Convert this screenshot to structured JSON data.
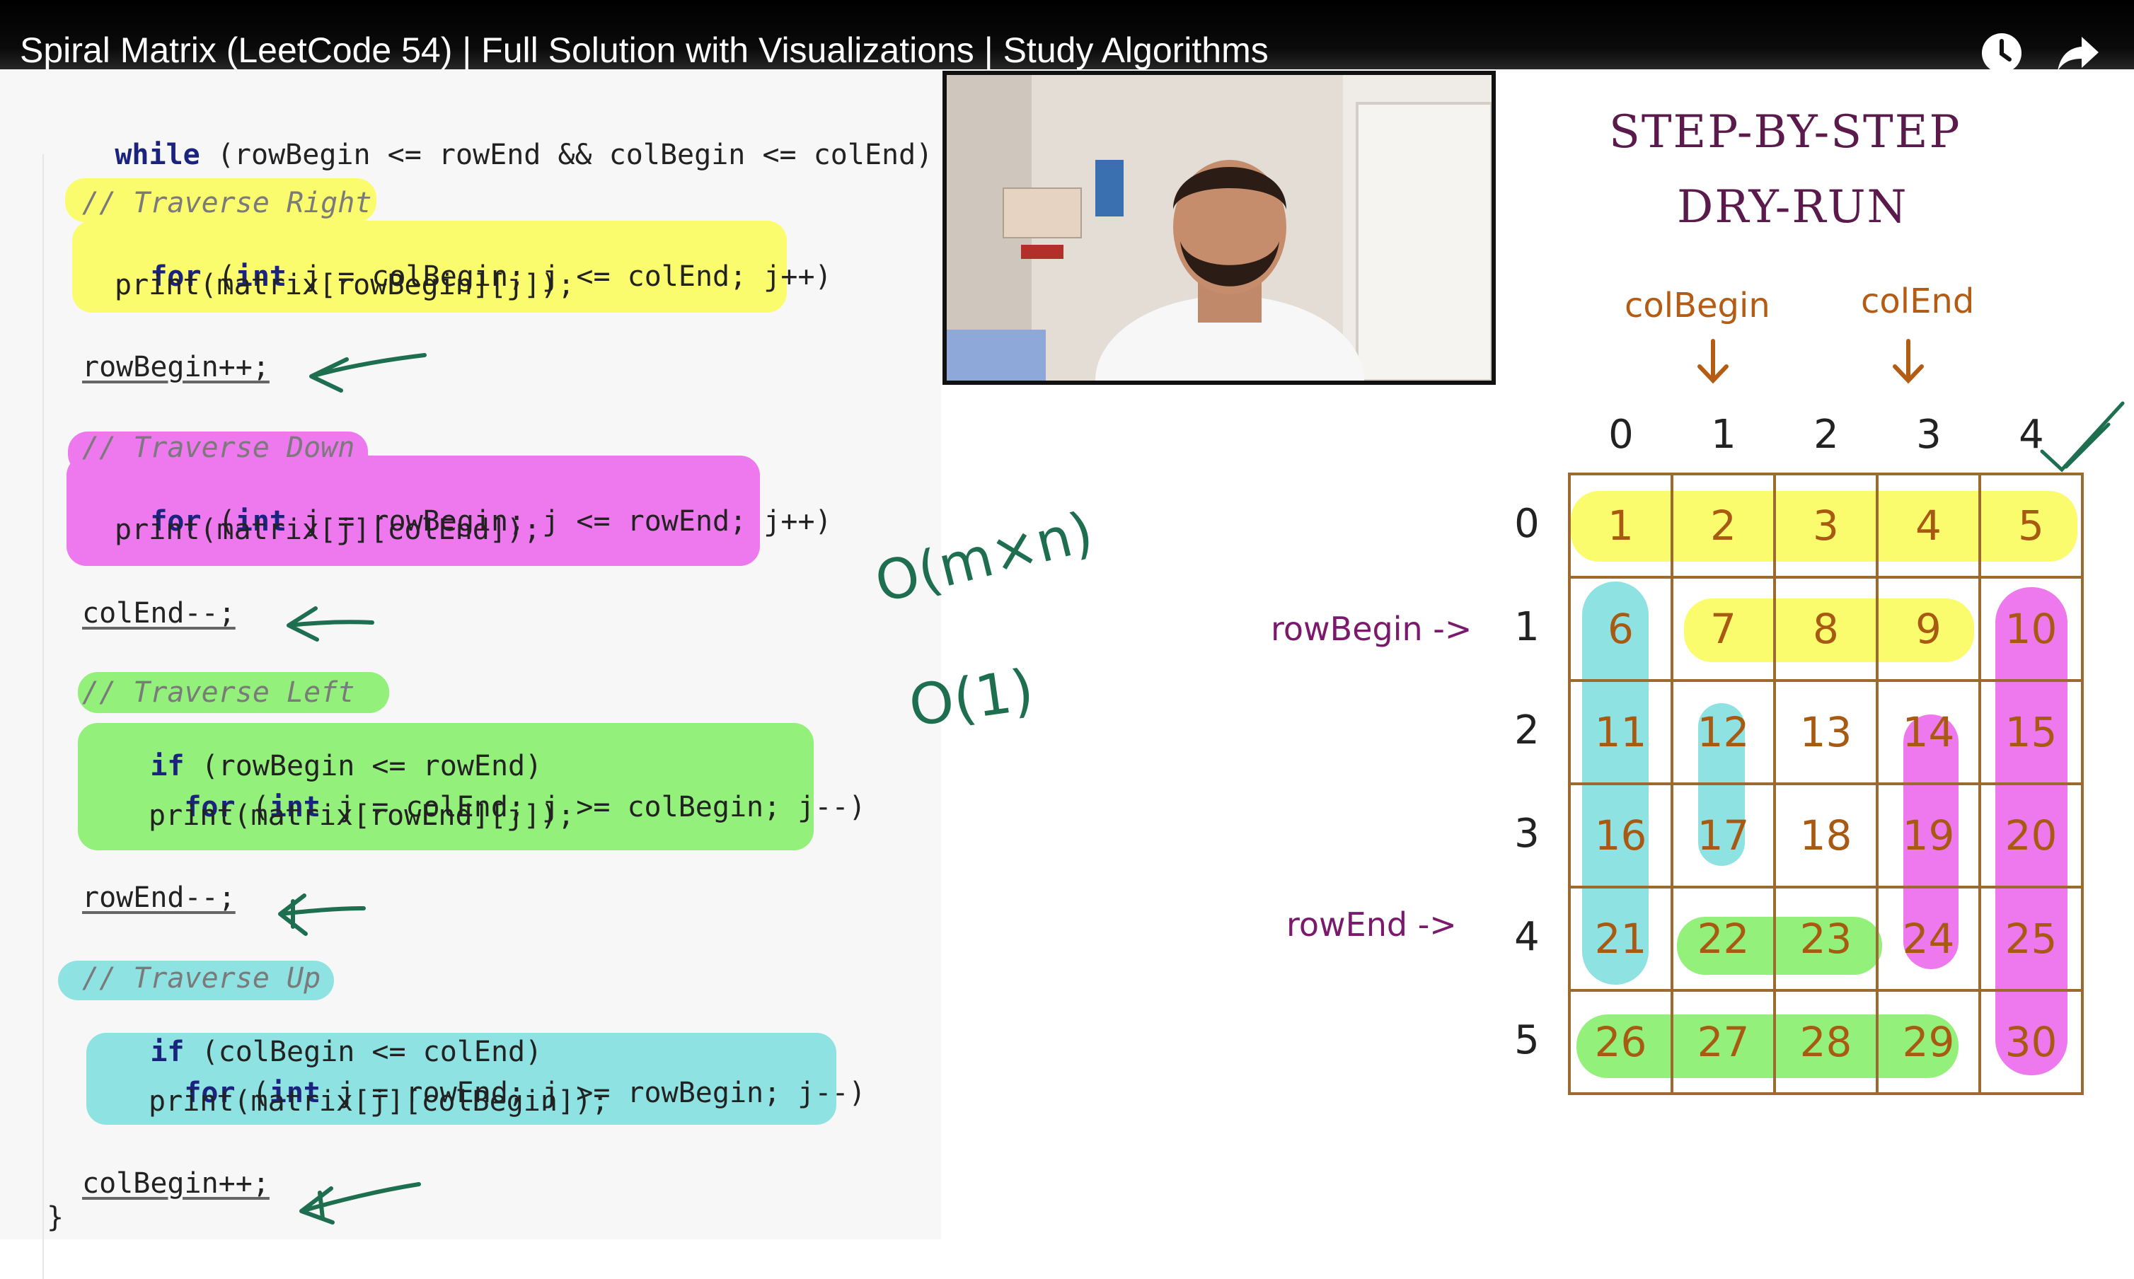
{
  "video": {
    "title": "Spiral Matrix (LeetCode 54) | Full Solution with Visualizations | Study Algorithms",
    "icons": [
      "clock-icon",
      "share-icon"
    ]
  },
  "code": {
    "header": {
      "kw": "while",
      "rest": " (rowBegin <= rowEnd && colBegin <= colEnd) {"
    },
    "right": {
      "comment": "// Traverse Right",
      "for_kw": "for",
      "for_open": " (",
      "int_kw": "int",
      "for_rest": " j = colBegin; j <= colEnd; j++)",
      "print": "print(matrix[rowBegin][j]);",
      "after": "rowBegin++;"
    },
    "down": {
      "comment": "// Traverse Down",
      "for_kw": "for",
      "for_open": " (",
      "int_kw": "int",
      "for_rest": " j = rowBegin; j <= rowEnd; j++)",
      "print": "print(matrix[j][colEnd]);",
      "after": "colEnd--;"
    },
    "left": {
      "comment": "// Traverse Left",
      "if_kw": "if",
      "if_rest": " (rowBegin <= rowEnd)",
      "for_kw": "for",
      "for_open": " (",
      "int_kw": "int",
      "for_rest": " j = colEnd; j >= colBegin; j--)",
      "print": "print(matrix[rowEnd][j]);",
      "after": "rowEnd--;"
    },
    "up": {
      "comment": "// Traverse Up",
      "if_kw": "if",
      "if_rest": " (colBegin <= colEnd)",
      "for_kw": "for",
      "for_open": " (",
      "int_kw": "int",
      "for_rest": " j = rowEnd; j >= rowBegin; j--)",
      "print": "print(matrix[j][colBegin]);",
      "after": "colBegin++;"
    },
    "closing": "}"
  },
  "diagram": {
    "title_line1": "Step-by-Step",
    "title_line2": "Dry-run",
    "col_begin_label": "colBegin",
    "col_end_label": "colEnd",
    "row_begin_label": "rowBegin ->",
    "row_end_label": "rowEnd ->",
    "col_indices": [
      "0",
      "1",
      "2",
      "3",
      "4"
    ],
    "row_indices": [
      "0",
      "1",
      "2",
      "3",
      "4",
      "5"
    ],
    "matrix": [
      [
        "1",
        "2",
        "3",
        "4",
        "5"
      ],
      [
        "6",
        "7",
        "8",
        "9",
        "10"
      ],
      [
        "11",
        "12",
        "13",
        "14",
        "15"
      ],
      [
        "16",
        "17",
        "18",
        "19",
        "20"
      ],
      [
        "21",
        "22",
        "23",
        "24",
        "25"
      ],
      [
        "26",
        "27",
        "28",
        "29",
        "30"
      ]
    ],
    "time_complexity": "O(m×n)",
    "space_complexity": "O(1)"
  },
  "colors": {
    "yellow": "#fbfb6e",
    "magenta": "#ee78ee",
    "green": "#93f07a",
    "cyan": "#8fe2e2",
    "pen_green": "#1e6e50"
  }
}
